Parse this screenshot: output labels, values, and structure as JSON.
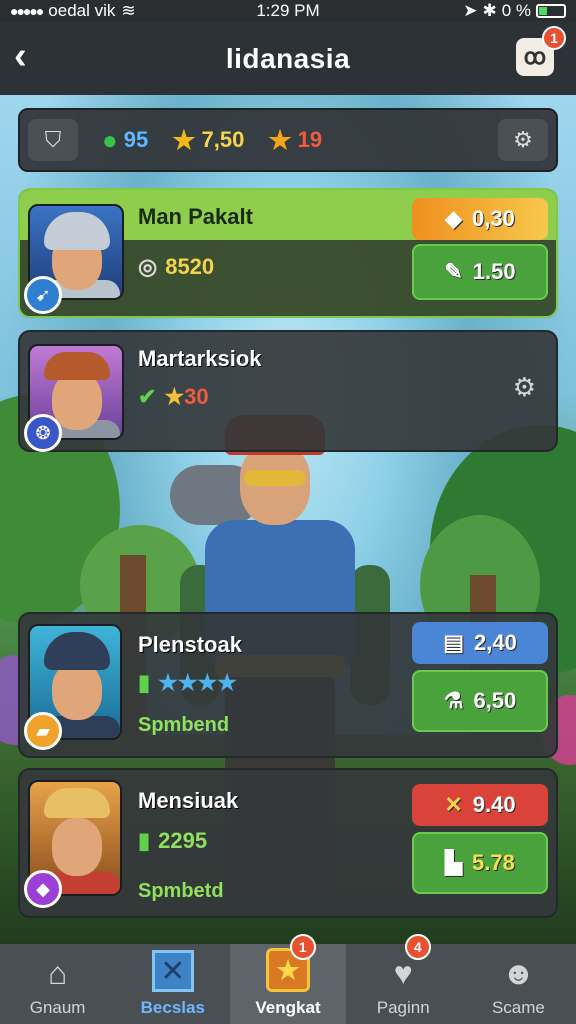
{
  "status_bar": {
    "carrier": "oedal vik",
    "time": "1:29 PM",
    "battery": "0 %"
  },
  "header": {
    "title": "lidanasia",
    "back_icon": "chevron-left-icon",
    "corner_icon": "infinity-icon",
    "corner_badge": "1"
  },
  "resources": {
    "gems": "95",
    "stars": "7,50",
    "tokens": "19"
  },
  "cards": [
    {
      "name": "Man Pakalt",
      "stat": "8520",
      "pill_top": "0,30",
      "pill_bottom": "1.50"
    },
    {
      "name": "Martarksiok",
      "stat": "30"
    },
    {
      "name": "Plenstoak",
      "subtext": "Spmbend",
      "pill_top": "2,40",
      "pill_bottom": "6,50"
    },
    {
      "name": "Mensiuak",
      "stat": "2295",
      "subtext": "Spmbetd",
      "pill_top": "9.40",
      "pill_bottom": "5.78"
    }
  ],
  "nav": {
    "tabs": [
      {
        "label": "Gnaum",
        "icon": "home-icon"
      },
      {
        "label": "Becslas",
        "icon": "crossed-swords-icon"
      },
      {
        "label": "Vengkat",
        "icon": "star-box-icon",
        "badge": "1"
      },
      {
        "label": "Paginn",
        "icon": "heart-icon",
        "badge": "4"
      },
      {
        "label": "Scame",
        "icon": "person-icon"
      }
    ]
  },
  "colors": {
    "active_card_border": "#7ec84a",
    "gem": "#5fb8ff",
    "star": "#f4d44b",
    "token": "#f05b3e",
    "badge": "#e8502f"
  }
}
